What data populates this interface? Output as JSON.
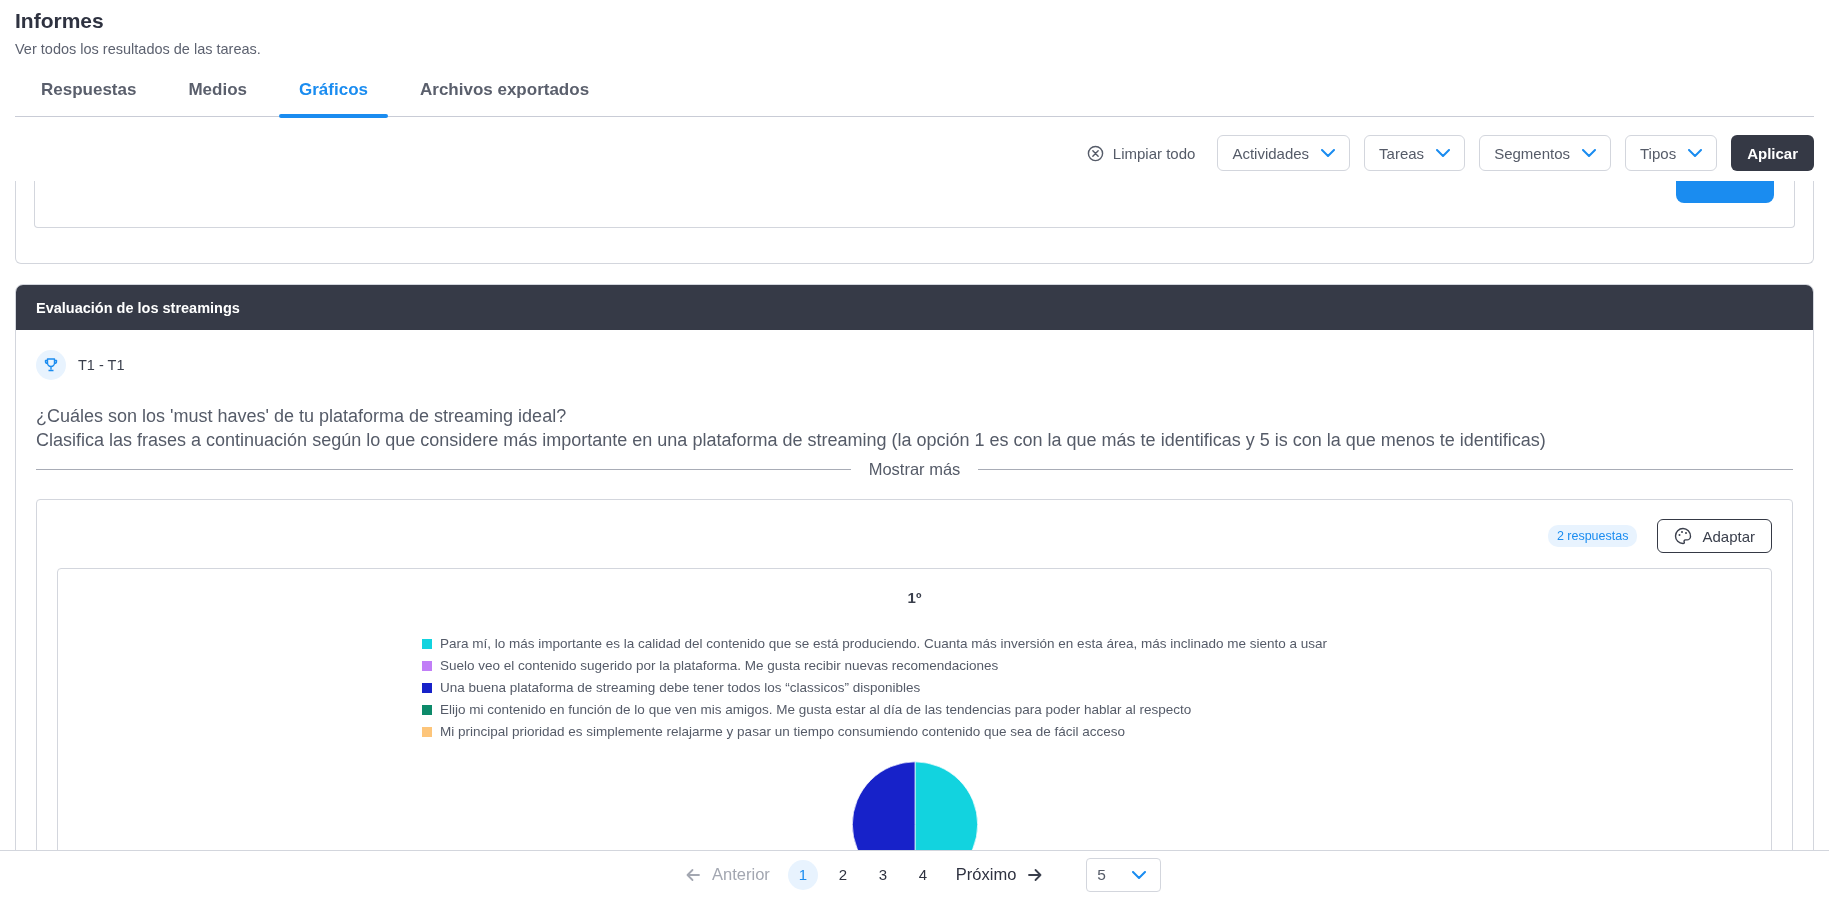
{
  "header": {
    "title": "Informes",
    "subtitle": "Ver todos los resultados de las tareas."
  },
  "tabs": [
    {
      "label": "Respuestas",
      "selected": false
    },
    {
      "label": "Medios",
      "selected": false
    },
    {
      "label": "Gráficos",
      "selected": true
    },
    {
      "label": "Archivos exportados",
      "selected": false
    }
  ],
  "filters": {
    "clear": "Limpiar todo",
    "dropdowns": [
      "Actividades",
      "Tareas",
      "Segmentos",
      "Tipos"
    ],
    "apply": "Aplicar"
  },
  "card": {
    "title": "Evaluación de los streamings",
    "task": "T1 - T1",
    "question": [
      "¿Cuáles son los 'must haves' de tu plataforma de streaming ideal?",
      "Clasifica las frases a continuación según lo que considere más importante en una plataforma de streaming (la opción 1 es con la que más te identificas y 5 is con la que menos te identificas)"
    ],
    "show_more": "Mostrar más",
    "responses": "2 respuestas",
    "adapt": "Adaptar",
    "legend": [
      {
        "label": "Para mí, lo más importante es la calidad del contenido que se está produciendo. Cuanta más inversión en esta área, más inclinado me siento a usar",
        "color": "#12d3df"
      },
      {
        "label": "Suelo veo el contenido sugerido por la plataforma. Me gusta recibir nuevas recomendaciones",
        "color": "#c17ef7"
      },
      {
        "label": "Una buena plataforma de streaming debe tener todos los “classicos” disponibles",
        "color": "#1722c9"
      },
      {
        "label": "Elijo mi contenido en función de lo que ven mis amigos. Me gusta estar al día de las tendencias para poder hablar al respecto",
        "color": "#0d8a6a"
      },
      {
        "label": "Mi principal prioridad es simplemente relajarme y pasar un tiempo consumiendo contenido que sea de fácil acceso",
        "color": "#fdc57a"
      }
    ],
    "chart_data": {
      "type": "pie",
      "title": "1º",
      "values": [
        50,
        0,
        50,
        0,
        0
      ]
    }
  },
  "pagination": {
    "prev": "Anterior",
    "pages": [
      {
        "label": "1",
        "selected": true
      },
      {
        "label": "2",
        "selected": false
      },
      {
        "label": "3",
        "selected": false
      },
      {
        "label": "4",
        "selected": false
      }
    ],
    "next": "Próximo",
    "page_size": "5"
  }
}
